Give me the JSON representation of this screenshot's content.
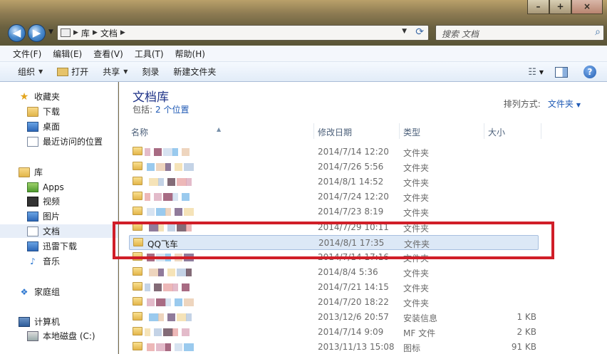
{
  "window": {
    "minimize": "–",
    "maximize": "+",
    "close": "×"
  },
  "nav": {
    "back": "◀",
    "forward": "▶"
  },
  "address": {
    "path": [
      "库",
      "文档"
    ]
  },
  "search": {
    "placeholder": "搜索 文档"
  },
  "menu": [
    "文件(F)",
    "编辑(E)",
    "查看(V)",
    "工具(T)",
    "帮助(H)"
  ],
  "commands": {
    "organize": "组织",
    "open": "打开",
    "share": "共享",
    "burn": "刻录",
    "new_folder": "新建文件夹"
  },
  "sidebar": {
    "favorites": "收藏夹",
    "favorites_items": [
      "下载",
      "桌面",
      "最近访问的位置"
    ],
    "libraries": "库",
    "library_items": [
      "Apps",
      "视频",
      "图片",
      "文档",
      "迅雷下载",
      "音乐"
    ],
    "homegroup": "家庭组",
    "computer": "计算机",
    "computer_items": [
      "本地磁盘 (C:)"
    ]
  },
  "library": {
    "title": "文档库",
    "includes_label": "包括:",
    "includes_link": "2 个位置",
    "arrange_label": "排列方式:",
    "arrange_value": "文件夹"
  },
  "columns": {
    "name": "名称",
    "date": "修改日期",
    "type": "类型",
    "size": "大小"
  },
  "files": [
    {
      "name": "",
      "date": "2014/7/14 12:20",
      "type": "文件夹",
      "size": ""
    },
    {
      "name": "",
      "date": "2014/7/26 5:56",
      "type": "文件夹",
      "size": ""
    },
    {
      "name": "",
      "date": "2014/8/1 14:52",
      "type": "文件夹",
      "size": ""
    },
    {
      "name": "",
      "date": "2014/7/24 12:20",
      "type": "文件夹",
      "size": ""
    },
    {
      "name": "",
      "date": "2014/7/23 8:19",
      "type": "文件夹",
      "size": ""
    },
    {
      "name": "",
      "date": "2014/7/29 10:11",
      "type": "文件夹",
      "size": ""
    },
    {
      "name": "QQ飞车",
      "date": "2014/8/1 17:35",
      "type": "文件夹",
      "size": ""
    },
    {
      "name": "",
      "date": "2014/7/14 17:16",
      "type": "文件夹",
      "size": ""
    },
    {
      "name": "",
      "date": "2014/8/4 5:36",
      "type": "文件夹",
      "size": ""
    },
    {
      "name": "",
      "date": "2014/7/21 14:15",
      "type": "文件夹",
      "size": ""
    },
    {
      "name": "",
      "date": "2014/7/20 18:22",
      "type": "文件夹",
      "size": ""
    },
    {
      "name": "",
      "date": "2013/12/6 20:57",
      "type": "安装信息",
      "size": "1 KB"
    },
    {
      "name": "",
      "date": "2014/7/14 9:09",
      "type": "MF 文件",
      "size": "2 KB"
    },
    {
      "name": "",
      "date": "2013/11/13 15:08",
      "type": "图标",
      "size": "91 KB"
    }
  ],
  "selected_index": 6,
  "colors": {
    "highlight_box": "#d01e28",
    "link": "#1f5ab5",
    "title": "#1e3287"
  }
}
